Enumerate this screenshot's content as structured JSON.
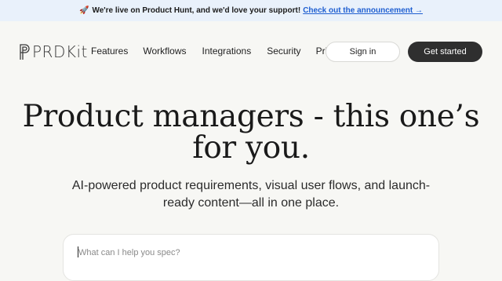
{
  "announcement": {
    "emoji": "🚀",
    "message": "We're live on Product Hunt, and we'd love your support!",
    "link_text": "Check out the announcement →"
  },
  "nav": {
    "logo_text": "PRDKit",
    "links": [
      "Features",
      "Workflows",
      "Integrations",
      "Security",
      "Pricing"
    ],
    "sign_in_label": "Sign in",
    "get_started_label": "Get started"
  },
  "hero": {
    "title": "Product managers - this one’s for you.",
    "subtitle": "AI-powered product requirements, visual user flows, and launch-ready content—all in one place."
  },
  "prompt": {
    "placeholder": "What can I help you spec?"
  },
  "colors": {
    "background": "#f7f7f4",
    "announcement_bg": "#e9f1fb",
    "link": "#1f5fd1",
    "primary_button": "#2f2f2f"
  },
  "icons": {
    "logo": "prdkit-logo-icon",
    "announcement": "rocket-icon"
  }
}
